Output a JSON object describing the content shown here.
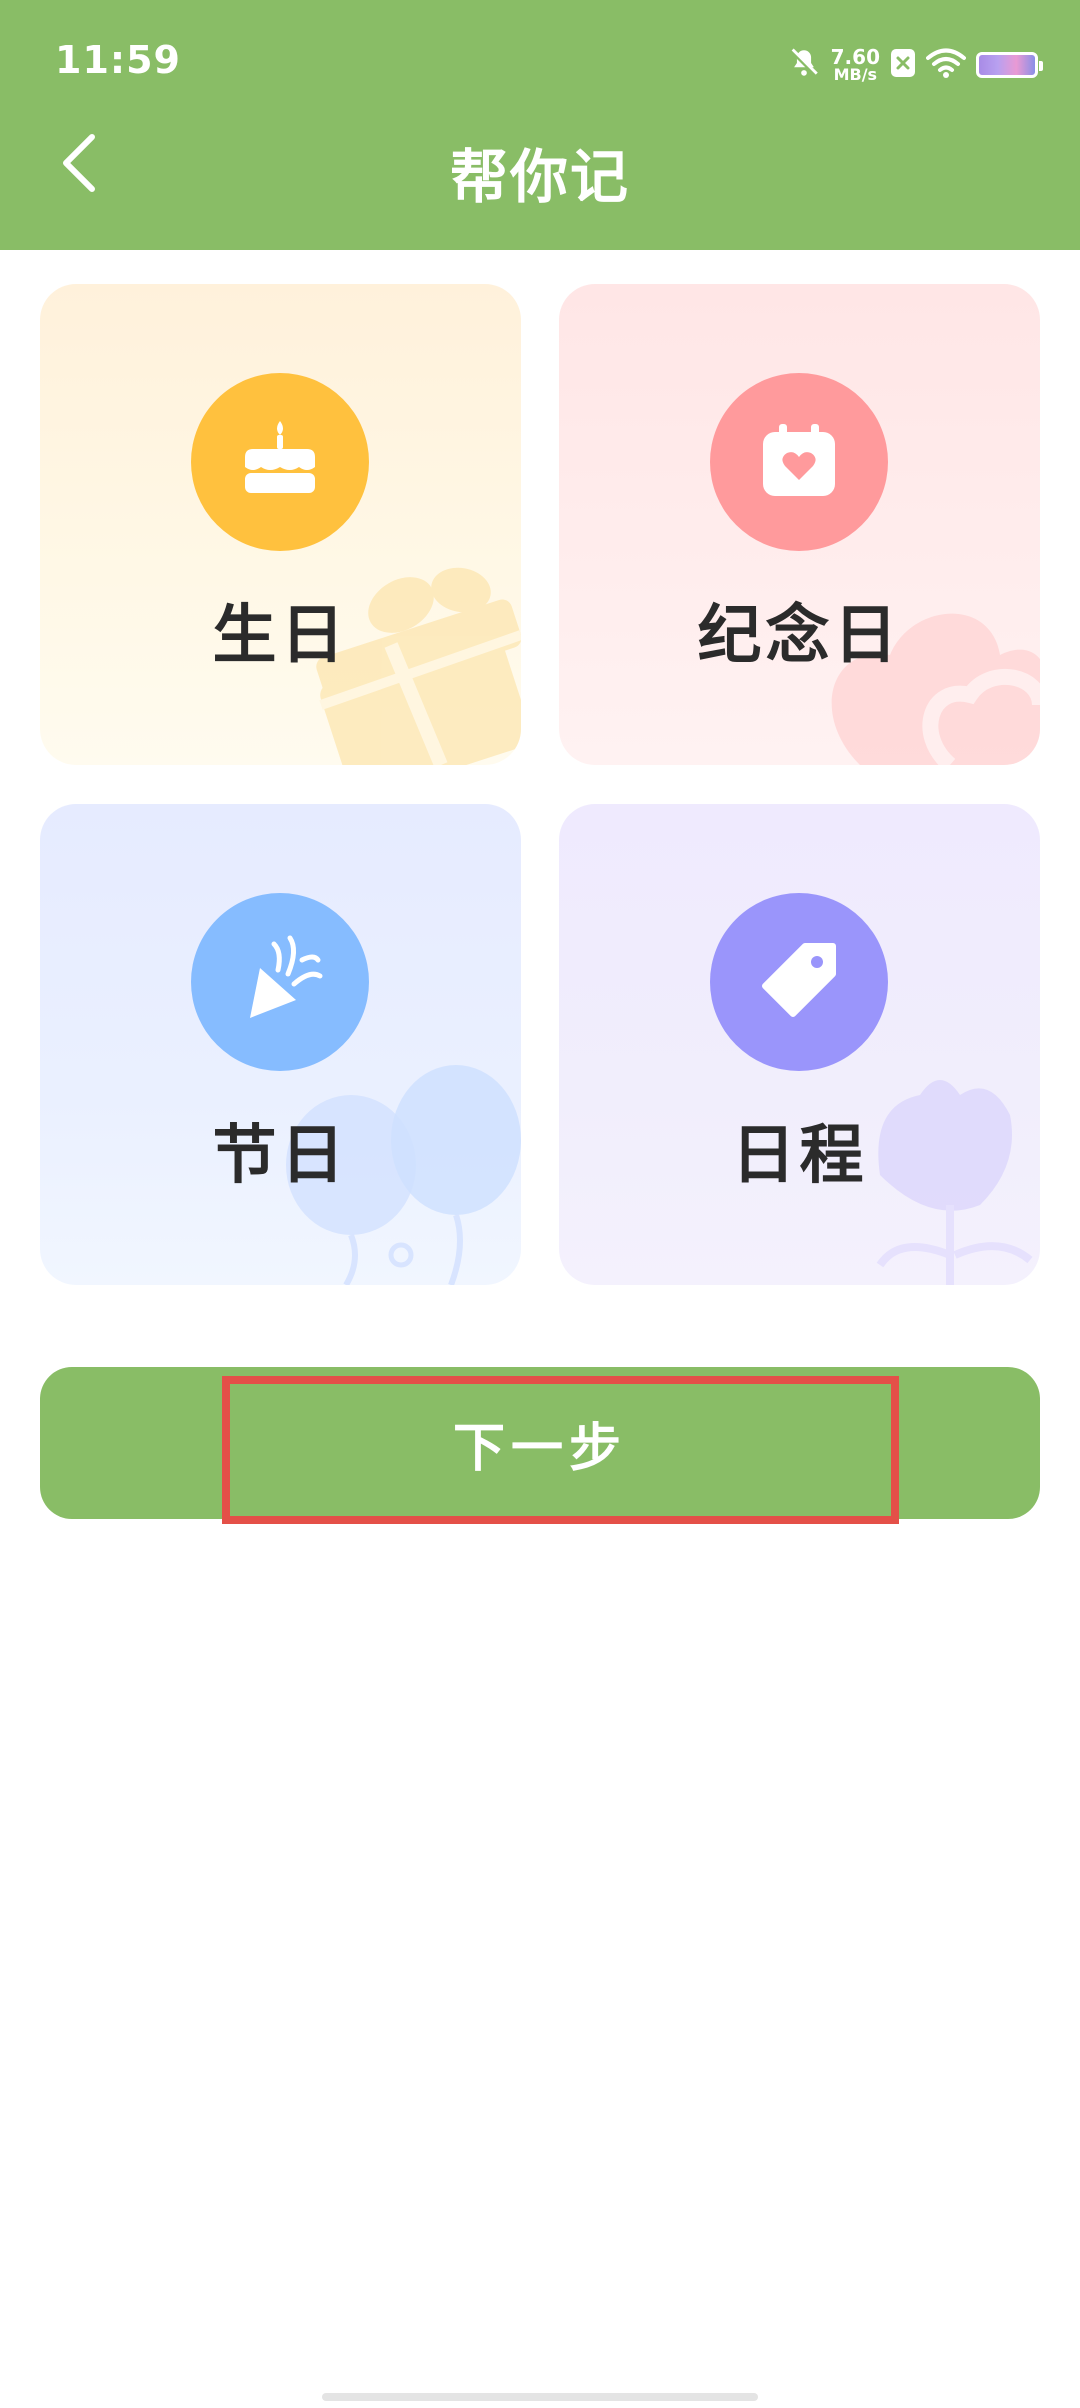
{
  "status_bar": {
    "time": "11:59",
    "net_speed_value": "7.60",
    "net_speed_unit": "MB/s",
    "icons": [
      "bell-muted-icon",
      "x-badge-icon",
      "wifi-icon",
      "battery-icon"
    ]
  },
  "header": {
    "title": "帮你记",
    "back_icon": "chevron-left-icon",
    "color": "#89bd66"
  },
  "cards": [
    {
      "label": "生日",
      "icon": "birthday-cake-icon",
      "color": "#ffc13e"
    },
    {
      "label": "纪念日",
      "icon": "calendar-heart-icon",
      "color": "#ff9a9c"
    },
    {
      "label": "节日",
      "icon": "party-popper-icon",
      "color": "#86bcff"
    },
    {
      "label": "日程",
      "icon": "tag-icon",
      "color": "#9a95fb"
    }
  ],
  "next_button": {
    "label": "下一步",
    "highlight_color": "#e45048"
  }
}
